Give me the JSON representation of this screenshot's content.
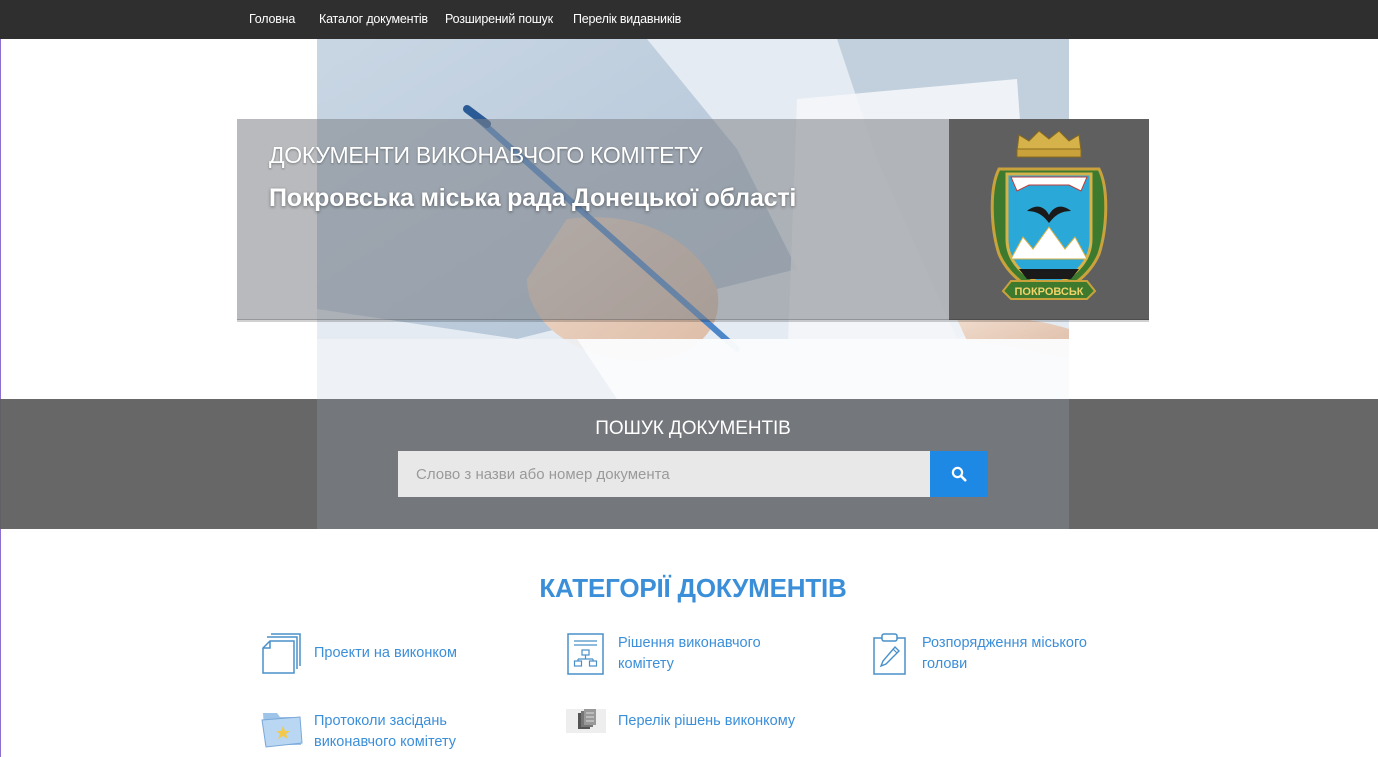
{
  "nav": {
    "items": [
      {
        "label": "Головна"
      },
      {
        "label": "Каталог документів"
      },
      {
        "label": "Розширений пошук"
      },
      {
        "label": "Перелік видавників"
      }
    ]
  },
  "hero": {
    "kicker": "ДОКУМЕНТИ ВИКОНАВЧОГО КОМІТЕТУ",
    "title": "Покровська міська рада Донецької області",
    "logo_icon": "coat-of-arms",
    "logo_caption": "ПОКРОВСЬК"
  },
  "search": {
    "heading": "ПОШУК ДОКУМЕНТІВ",
    "placeholder": "Слово з назви або номер документа",
    "value": "",
    "button_icon": "search-icon"
  },
  "categories": {
    "heading": "КАТЕГОРІЇ ДОКУМЕНТІВ",
    "items": [
      {
        "label": "Проекти на виконком",
        "icon": "documents-stack-icon"
      },
      {
        "label": "Рішення виконавчого комітету",
        "icon": "structure-document-icon"
      },
      {
        "label": "Розпорядження міського голови",
        "icon": "clipboard-pen-icon"
      },
      {
        "label": "Протоколи засідань виконавчого комітету",
        "icon": "star-folder-icon"
      },
      {
        "label": "Перелік рішень виконкому",
        "icon": "file-cabinet-icon"
      }
    ]
  },
  "colors": {
    "nav_bg": "#2f2f2f",
    "accent": "#1e88e5",
    "link": "#3b8fd9",
    "band": "#5f5f5f"
  }
}
